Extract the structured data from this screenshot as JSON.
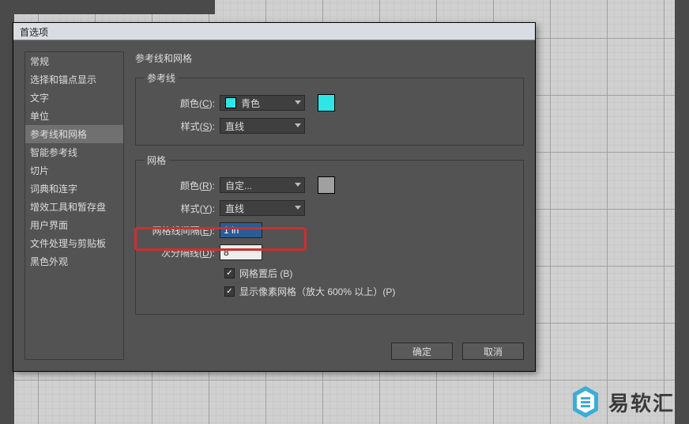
{
  "dialog": {
    "title": "首选项"
  },
  "sidebar": {
    "items": [
      {
        "label": "常规"
      },
      {
        "label": "选择和锚点显示"
      },
      {
        "label": "文字"
      },
      {
        "label": "单位"
      },
      {
        "label": "参考线和网格",
        "selected": true
      },
      {
        "label": "智能参考线"
      },
      {
        "label": "切片"
      },
      {
        "label": "词典和连字"
      },
      {
        "label": "增效工具和暂存盘"
      },
      {
        "label": "用户界面"
      },
      {
        "label": "文件处理与剪贴板"
      },
      {
        "label": "黑色外观"
      }
    ]
  },
  "main": {
    "title": "参考线和网格",
    "guides": {
      "legend": "参考线",
      "color_label": "颜色(",
      "color_hotkey": "C",
      "color_label_end": "):",
      "color_value": "青色",
      "color_hex": "#2fe6e6",
      "style_label": "样式(",
      "style_hotkey": "S",
      "style_label_end": "):",
      "style_value": "直线"
    },
    "grid": {
      "legend": "网格",
      "color_label": "颜色(",
      "color_hotkey": "R",
      "color_label_end": "):",
      "color_value": "自定...",
      "color_hex": "#a0a0a0",
      "style_label": "样式(",
      "style_hotkey": "Y",
      "style_label_end": "):",
      "style_value": "直线",
      "spacing_label": "网格线间隔(",
      "spacing_hotkey": "E",
      "spacing_label_end": "):",
      "spacing_value": "1 in",
      "subdiv_label": "次分隔线(",
      "subdiv_hotkey": "D",
      "subdiv_label_end": "):",
      "subdiv_value": "8",
      "cb1_label": "网格置后 (",
      "cb1_hotkey": "B",
      "cb1_end": ")",
      "cb1_checked": true,
      "cb2_label": "显示像素网格（放大 600% 以上）(",
      "cb2_hotkey": "P",
      "cb2_end": ")",
      "cb2_checked": true
    },
    "buttons": {
      "ok": "确定",
      "cancel": "取消"
    }
  },
  "watermark": {
    "text": "易软汇",
    "icon_color": "#3aaed8"
  }
}
